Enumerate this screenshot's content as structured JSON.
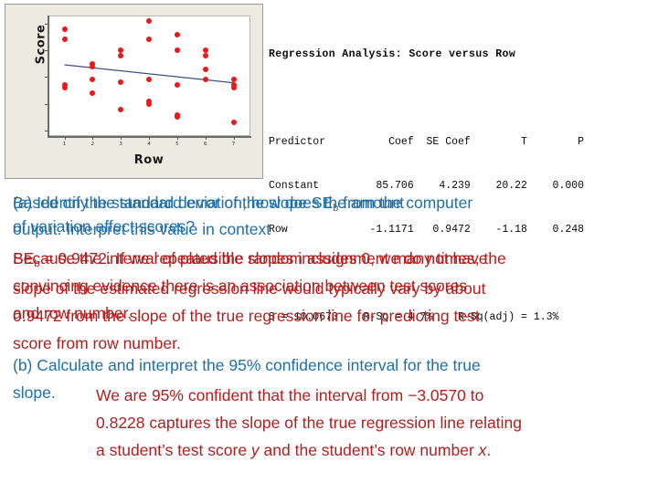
{
  "chart_data": {
    "type": "scatter",
    "title": "",
    "xlabel": "Row",
    "ylabel": "Score",
    "xlim": [
      0.4,
      7.6
    ],
    "ylim": [
      58,
      103
    ],
    "xticks": [
      "1",
      "2",
      "3",
      "4",
      "5",
      "6",
      "7"
    ],
    "yticks": [
      "100",
      "90",
      "80",
      "70",
      "60"
    ],
    "grid": false,
    "legend": "none",
    "point_color": "#e8191b",
    "line_color": "#3d4f86",
    "panel_color": "#EDEAE1",
    "regression_line": {
      "intercept": 85.706,
      "slope": -1.1171,
      "x_start": 1,
      "x_end": 7,
      "y_start": 84.59,
      "y_end": 77.88
    },
    "points": [
      {
        "x": 1,
        "y": 98
      },
      {
        "x": 1,
        "y": 94
      },
      {
        "x": 1,
        "y": 77
      },
      {
        "x": 1,
        "y": 76
      },
      {
        "x": 2,
        "y": 85
      },
      {
        "x": 2,
        "y": 84
      },
      {
        "x": 2,
        "y": 79
      },
      {
        "x": 2,
        "y": 74
      },
      {
        "x": 3,
        "y": 90
      },
      {
        "x": 3,
        "y": 88
      },
      {
        "x": 3,
        "y": 78
      },
      {
        "x": 3,
        "y": 68
      },
      {
        "x": 4,
        "y": 101
      },
      {
        "x": 4,
        "y": 94
      },
      {
        "x": 4,
        "y": 79
      },
      {
        "x": 4,
        "y": 71
      },
      {
        "x": 4,
        "y": 70
      },
      {
        "x": 5,
        "y": 96
      },
      {
        "x": 5,
        "y": 90
      },
      {
        "x": 5,
        "y": 77
      },
      {
        "x": 5,
        "y": 66
      },
      {
        "x": 5,
        "y": 65
      },
      {
        "x": 6,
        "y": 90
      },
      {
        "x": 6,
        "y": 88
      },
      {
        "x": 6,
        "y": 83
      },
      {
        "x": 6,
        "y": 79
      },
      {
        "x": 7,
        "y": 79
      },
      {
        "x": 7,
        "y": 77
      },
      {
        "x": 7,
        "y": 76
      },
      {
        "x": 7,
        "y": 63
      }
    ]
  },
  "minitab": {
    "title": "Regression Analysis: Score versus Row",
    "header": "Predictor          Coef  SE Coef        T        P",
    "rows": [
      "Constant         85.706    4.239    20.22    0.000",
      "Row             -1.1171   0.9472    -1.18    0.248"
    ],
    "summary": "S = 10.0673    R-Sq = 4.7%    R-Sq(adj) = 1.3%",
    "values": {
      "constant_coef": 85.706,
      "constant_se": 4.239,
      "constant_t": 20.22,
      "constant_p": 0.0,
      "row_coef": -1.1171,
      "row_se": 0.9472,
      "row_t": -1.18,
      "row_p": 0.248,
      "s": 10.0673,
      "r_sq": "4.7%",
      "r_sq_adj": "1.3%"
    }
  },
  "slide_text": {
    "question_a_line1": "(a) Identify the standard error of the slope SE",
    "question_a_sub": "b",
    "question_a_line1_end": " from the computer",
    "question_a_line2": "output. Interpret this value in context",
    "question_a_alt_line1": "Based on the standard deviation, how does the amount",
    "question_a_alt_line2": "of variation affect scores?",
    "answer_a_line1": "SE",
    "answer_a_sub": "b",
    "answer_a_line1_end": " = 0.9472. If we repeated the random assignment many times, the",
    "answer_a_line2": "slope of the estimated regression line would typically vary by about",
    "answer_a_line3": "0.9472 from the slope of the true regression line for predicting test",
    "answer_a_line4": "score from row number.",
    "answer_a_alt_line1": "Because the interval of plausible slopes includes 0, we do not have",
    "answer_a_alt_line2": "convincing evidence there is an association between test scores",
    "answer_a_alt_line3": "and row number.",
    "question_b_line1": "(b) Calculate  and interpret the 95% confidence interval for the true",
    "question_b_line2": "slope.",
    "answer_b_line1": "We are 95% confident that the interval from −3.0570 to",
    "answer_b_line2": "0.8228 captures the slope of the true regression line relating",
    "answer_b_line3_pre": "a student’s test score ",
    "answer_b_line3_var1": "y",
    "answer_b_line3_mid": " and the student’s row number ",
    "answer_b_line3_var2": "x",
    "answer_b_line3_end": "."
  }
}
